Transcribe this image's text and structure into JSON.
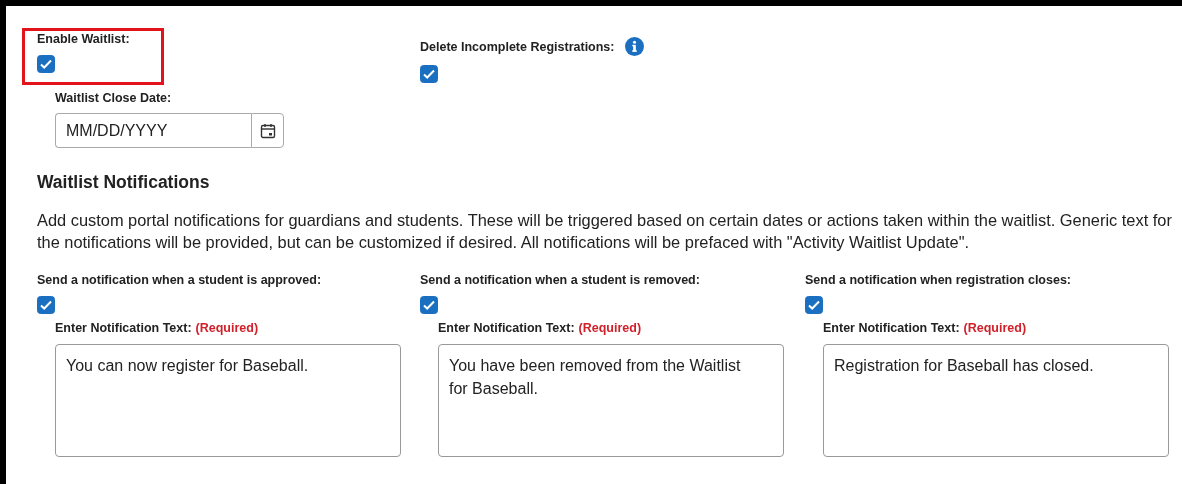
{
  "top_fields": [
    {
      "label": "Enable Waitlist:",
      "checked": true,
      "highlighted": true
    },
    {
      "label": "Delete Incomplete Registrations:",
      "checked": true,
      "highlighted": false,
      "info": true
    }
  ],
  "close_date": {
    "label": "Waitlist Close Date:",
    "placeholder": "MM/DD/YYYY"
  },
  "section": {
    "title": "Waitlist Notifications",
    "description": "Add custom portal notifications for guardians and students. These will be triggered based on certain dates or actions taken within the waitlist. Generic text for the notifications will be provided, but can be customized if desired. All notifications will be prefaced with \"Activity Waitlist Update\"."
  },
  "notifications": [
    {
      "label": "Send a notification when a student is approved:",
      "checked": true,
      "text_label": "Enter Notification Text:",
      "required": "(Required)",
      "value": "You can now register for Baseball."
    },
    {
      "label": "Send a notification when a student is removed:",
      "checked": true,
      "text_label": "Enter Notification Text:",
      "required": "(Required)",
      "value": "You have been removed from the Waitlist for Baseball."
    },
    {
      "label": "Send a notification when registration closes:",
      "checked": true,
      "text_label": "Enter Notification Text:",
      "required": "(Required)",
      "value": "Registration for Baseball has closed."
    }
  ]
}
